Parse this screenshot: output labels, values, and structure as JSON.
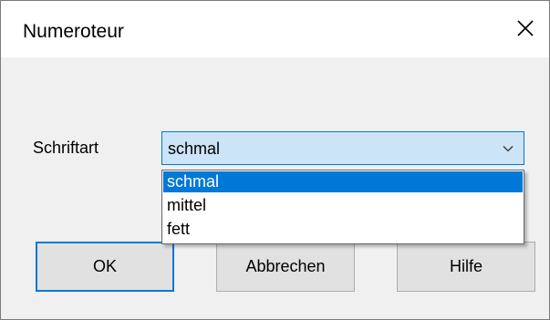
{
  "window": {
    "title": "Numeroteur",
    "close_icon": "close-icon"
  },
  "form": {
    "font_label": "Schriftart",
    "font_select": {
      "value": "schmal",
      "options": [
        "schmal",
        "mittel",
        "fett"
      ],
      "selected_index": 0,
      "expanded": true,
      "arrow_icon": "chevron-down-icon"
    }
  },
  "buttons": {
    "ok_label": "OK",
    "cancel_label": "Abbrechen",
    "help_label": "Hilfe"
  },
  "colors": {
    "accent": "#0078d7",
    "combo_background": "#cce4f7",
    "dialog_background": "#f0f0f0",
    "titlebar_background": "#ffffff",
    "button_background": "#e1e1e1"
  }
}
